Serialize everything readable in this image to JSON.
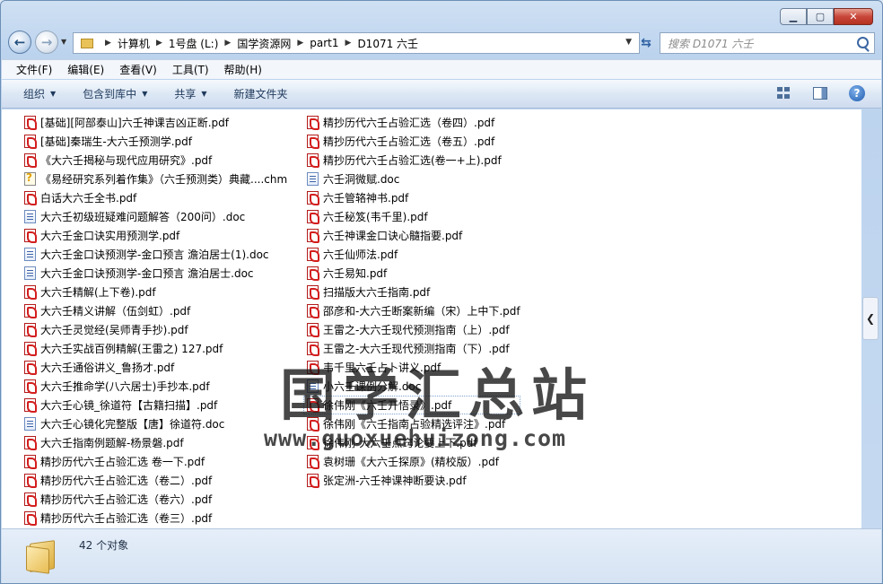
{
  "window": {
    "minimize": "▁",
    "maximize": "▢",
    "close": "✕"
  },
  "address": {
    "crumbs": [
      "计算机",
      "1号盘 (L:)",
      "国学资源网",
      "part1",
      "D1071 六壬"
    ],
    "search_placeholder": "搜索 D1071 六壬"
  },
  "menu": [
    "文件(F)",
    "编辑(E)",
    "查看(V)",
    "工具(T)",
    "帮助(H)"
  ],
  "toolbar": {
    "organize": "组织",
    "include": "包含到库中",
    "share": "共享",
    "new_folder": "新建文件夹"
  },
  "files_col1": [
    {
      "name": "[基础][阿部泰山]六壬神课吉凶正断.pdf",
      "type": "pdf"
    },
    {
      "name": "[基础]秦瑞生-大六壬预测学.pdf",
      "type": "pdf"
    },
    {
      "name": "《大六壬揭秘与现代应用研究》.pdf",
      "type": "pdf"
    },
    {
      "name": "《易经研究系列着作集》（六壬预测类）典藏....chm",
      "type": "chm"
    },
    {
      "name": "白话大六壬全书.pdf",
      "type": "pdf"
    },
    {
      "name": "大六壬初级班疑难问题解答（200问）.doc",
      "type": "doc"
    },
    {
      "name": "大六壬金口诀实用预测学.pdf",
      "type": "pdf"
    },
    {
      "name": "大六壬金口诀预测学-金口预言 澹泊居士(1).doc",
      "type": "doc"
    },
    {
      "name": "大六壬金口诀预测学-金口预言 澹泊居士.doc",
      "type": "doc"
    },
    {
      "name": "大六壬精解(上下卷).pdf",
      "type": "pdf"
    },
    {
      "name": "大六壬精义讲解（伍剑虹）.pdf",
      "type": "pdf"
    },
    {
      "name": "大六壬灵觉经(吴师青手抄).pdf",
      "type": "pdf"
    },
    {
      "name": "大六壬实战百例精解(王雷之) 127.pdf",
      "type": "pdf"
    },
    {
      "name": "大六壬通俗讲义_鲁扬才.pdf",
      "type": "pdf"
    },
    {
      "name": "大六壬推命学(八六居士)手抄本.pdf",
      "type": "pdf"
    },
    {
      "name": "大六壬心镜_徐道符【古籍扫描】.pdf",
      "type": "pdf"
    },
    {
      "name": "大六壬心镜化完整版【唐】徐道符.doc",
      "type": "doc"
    },
    {
      "name": "大六壬指南例题解-杨景磐.pdf",
      "type": "pdf"
    },
    {
      "name": "精抄历代六壬占验汇选 卷一下.pdf",
      "type": "pdf"
    },
    {
      "name": "精抄历代六壬占验汇选（卷二）.pdf",
      "type": "pdf"
    },
    {
      "name": "精抄历代六壬占验汇选（卷六）.pdf",
      "type": "pdf"
    },
    {
      "name": "精抄历代六壬占验汇选（卷三）.pdf",
      "type": "pdf"
    }
  ],
  "files_col2": [
    {
      "name": "精抄历代六壬占验汇选（卷四）.pdf",
      "type": "pdf"
    },
    {
      "name": "精抄历代六壬占验汇选（卷五）.pdf",
      "type": "pdf"
    },
    {
      "name": "精抄历代六壬占验汇选(卷一+上).pdf",
      "type": "pdf"
    },
    {
      "name": "六壬洞微赋.doc",
      "type": "doc"
    },
    {
      "name": "六壬管辂神书.pdf",
      "type": "pdf"
    },
    {
      "name": "六壬秘笈(韦千里).pdf",
      "type": "pdf"
    },
    {
      "name": "六壬神课金口诀心髓指要.pdf",
      "type": "pdf"
    },
    {
      "name": "六壬仙师法.pdf",
      "type": "pdf"
    },
    {
      "name": "六壬易知.pdf",
      "type": "pdf"
    },
    {
      "name": "扫描版大六壬指南.pdf",
      "type": "pdf"
    },
    {
      "name": "邵彦和-大六壬断案新编（宋）上中下.pdf",
      "type": "pdf"
    },
    {
      "name": "王雷之-大六壬现代预测指南（上）.pdf",
      "type": "pdf"
    },
    {
      "name": "王雷之-大六壬现代预测指南（下）.pdf",
      "type": "pdf"
    },
    {
      "name": "韦千里六壬占卜讲义.pdf",
      "type": "pdf"
    },
    {
      "name": "小六壬课例分解.doc",
      "type": "doc"
    },
    {
      "name": "徐伟刚《六壬开悟录》.pdf",
      "type": "pdf",
      "selected": true
    },
    {
      "name": "徐伟刚《六壬指南占验精选评注》.pdf",
      "type": "pdf"
    },
    {
      "name": "徐伟刚-大六壬点窍论要上下.pdf",
      "type": "pdf"
    },
    {
      "name": "袁树珊《大六壬探原》(精校版）.pdf",
      "type": "pdf"
    },
    {
      "name": "张定洲-六壬神课神断要诀.pdf",
      "type": "pdf"
    }
  ],
  "watermark": {
    "title": "国学汇总站",
    "url": "www.guoxuehuizong.com"
  },
  "status": {
    "count": "42 个对象"
  }
}
